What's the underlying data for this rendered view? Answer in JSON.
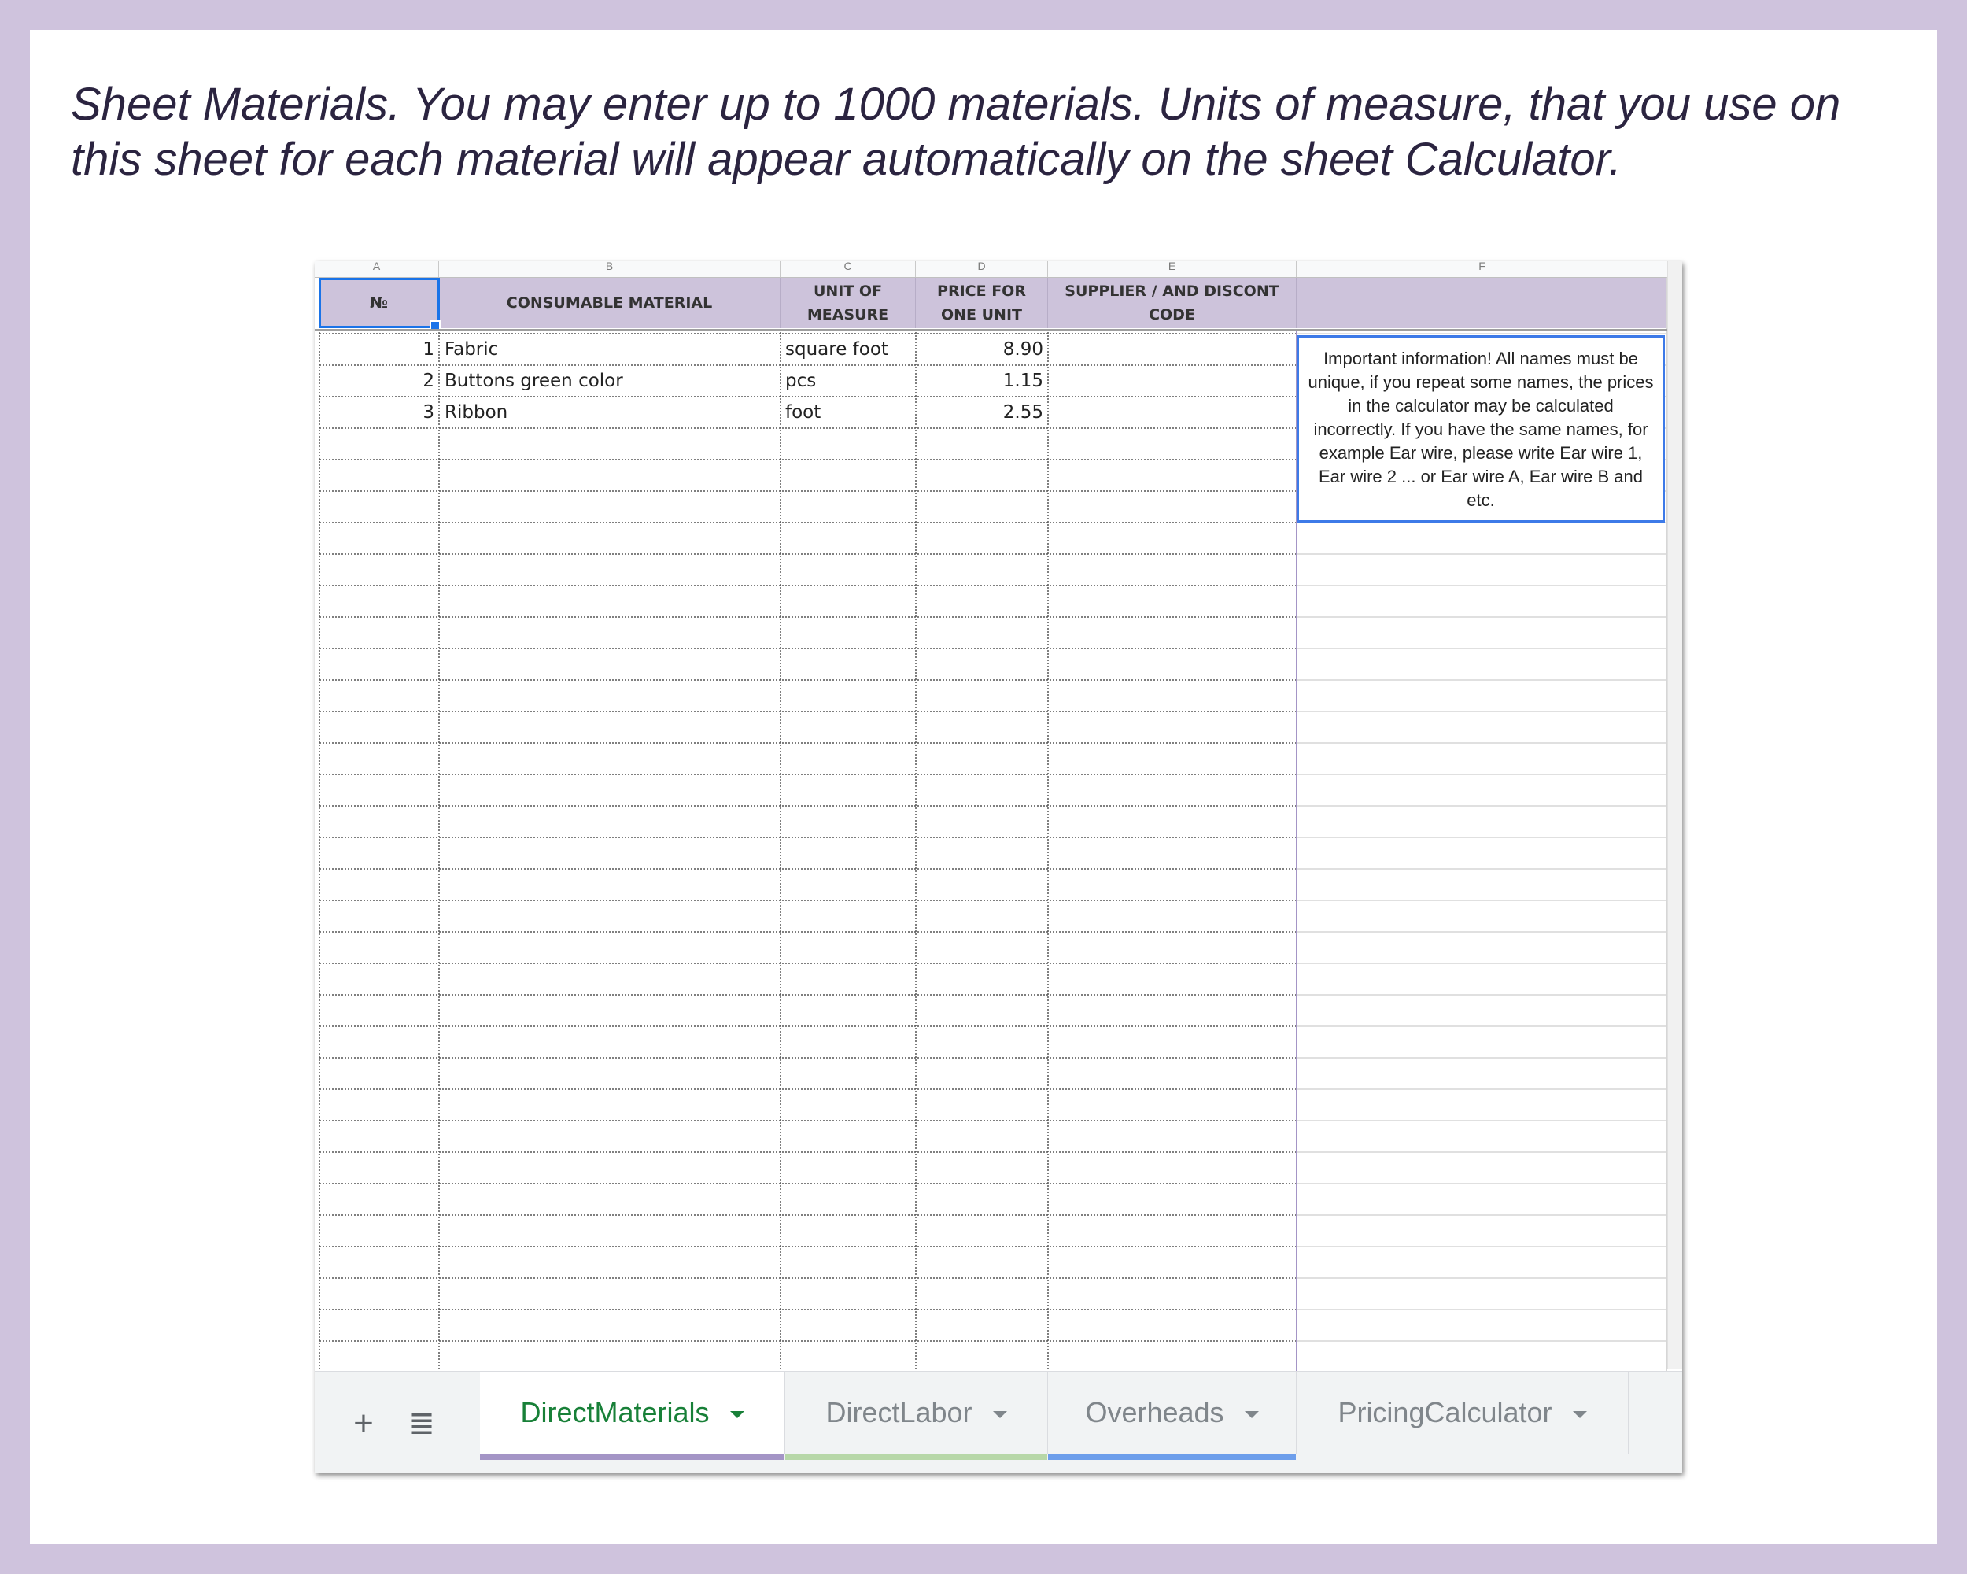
{
  "intro": {
    "line1": "Sheet Materials. You may enter up to 1000 materials. Units of measure, that you use on",
    "line2": "this sheet for each material will appear automatically on the sheet Calculator."
  },
  "column_letters": [
    "A",
    "B",
    "C",
    "D",
    "E",
    "F"
  ],
  "headers": {
    "no": "№",
    "material": "CONSUMABLE MATERIAL",
    "unit_line1": "UNIT OF",
    "unit_line2": "MEASURE",
    "price_line1": "PRICE FOR",
    "price_line2": "ONE UNIT",
    "supplier_line1": "SUPPLIER / AND DISCONT",
    "supplier_line2": "CODE"
  },
  "rows": [
    {
      "no": "1",
      "material": "Fabric",
      "unit": "square foot",
      "price": "8.90",
      "supplier": ""
    },
    {
      "no": "2",
      "material": "Buttons green color",
      "unit": "pcs",
      "price": "1.15",
      "supplier": ""
    },
    {
      "no": "3",
      "material": "Ribbon",
      "unit": "foot",
      "price": "2.55",
      "supplier": ""
    }
  ],
  "note": "Important information! All names must be unique, if you repeat some names, the prices in the calculator may be calculated incorrectly. If you have the same names, for example Ear wire, please write Ear wire 1, Ear wire 2 ... or Ear wire A, Ear wire B and etc.",
  "tabbar": {
    "add_icon": "plus-icon",
    "list_icon": "list-icon",
    "tabs": [
      {
        "label": "DirectMaterials",
        "underline": "#a495c6",
        "active": true
      },
      {
        "label": "DirectLabor",
        "underline": "#b7d7a8",
        "active": false
      },
      {
        "label": "Overheads",
        "underline": "#6d9eeb",
        "active": false
      },
      {
        "label": "PricingCalculator",
        "underline": "",
        "active": false
      }
    ]
  },
  "colors": {
    "frame": "#cfc3dd",
    "header_band": "#cdc3db",
    "selection": "#1a73e8",
    "active_tab_text": "#188038"
  }
}
